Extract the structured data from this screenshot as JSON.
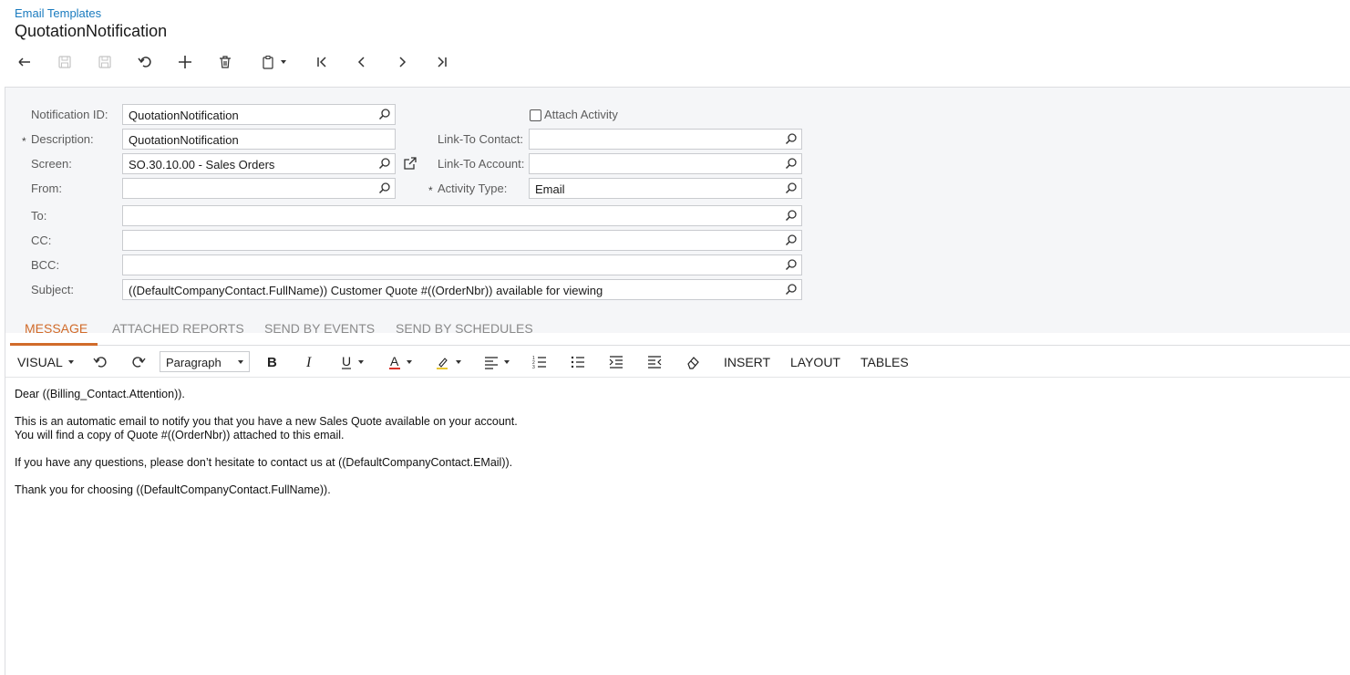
{
  "breadcrumb": "Email Templates",
  "title": "QuotationNotification",
  "toolbar": {
    "icons": [
      "back-icon",
      "save-close-icon",
      "save-icon",
      "undo-icon",
      "add-icon",
      "delete-icon",
      "copy-paste-icon",
      "first-icon",
      "previous-icon",
      "next-icon",
      "last-icon"
    ]
  },
  "form": {
    "notification_id": {
      "label": "Notification ID:",
      "value": "QuotationNotification"
    },
    "description": {
      "label": "Description:",
      "value": "QuotationNotification",
      "required_mark": "*"
    },
    "screen": {
      "label": "Screen:",
      "value": "SO.30.10.00 - Sales Orders"
    },
    "from": {
      "label": "From:",
      "value": ""
    },
    "attach_activity": {
      "label": "Attach Activity",
      "checked": false
    },
    "link_to_contact": {
      "label": "Link-To Contact:",
      "value": ""
    },
    "link_to_account": {
      "label": "Link-To Account:",
      "value": ""
    },
    "activity_type": {
      "label": "Activity Type:",
      "value": "Email",
      "required_mark": "*"
    },
    "to": {
      "label": "To:",
      "value": ""
    },
    "cc": {
      "label": "CC:",
      "value": ""
    },
    "bcc": {
      "label": "BCC:",
      "value": ""
    },
    "subject": {
      "label": "Subject:",
      "value": "((DefaultCompanyContact.FullName)) Customer Quote #((OrderNbr)) available for viewing"
    }
  },
  "tabs": [
    {
      "label": "MESSAGE",
      "active": true
    },
    {
      "label": "ATTACHED REPORTS",
      "active": false
    },
    {
      "label": "SEND BY EVENTS",
      "active": false
    },
    {
      "label": "SEND BY SCHEDULES",
      "active": false
    }
  ],
  "editor_toolbar": {
    "mode": "VISUAL",
    "paragraph": "Paragraph",
    "insert": "INSERT",
    "layout": "LAYOUT",
    "tables": "TABLES"
  },
  "message": {
    "line1": "Dear ((Billing_Contact.Attention)).",
    "line2": "This is an automatic email to notify you that you have a new Sales Quote available on your account.",
    "line3": "You will find a copy of Quote #((OrderNbr)) attached to this email.",
    "line4": "If you have any questions, please don’t hesitate to contact us at ((DefaultCompanyContact.EMail)).",
    "line5": "Thank you for choosing ((DefaultCompanyContact.FullName))."
  },
  "colors": {
    "accent": "#d16b2a",
    "link": "#1a7bbf",
    "panel_bg": "#f5f6f8"
  }
}
